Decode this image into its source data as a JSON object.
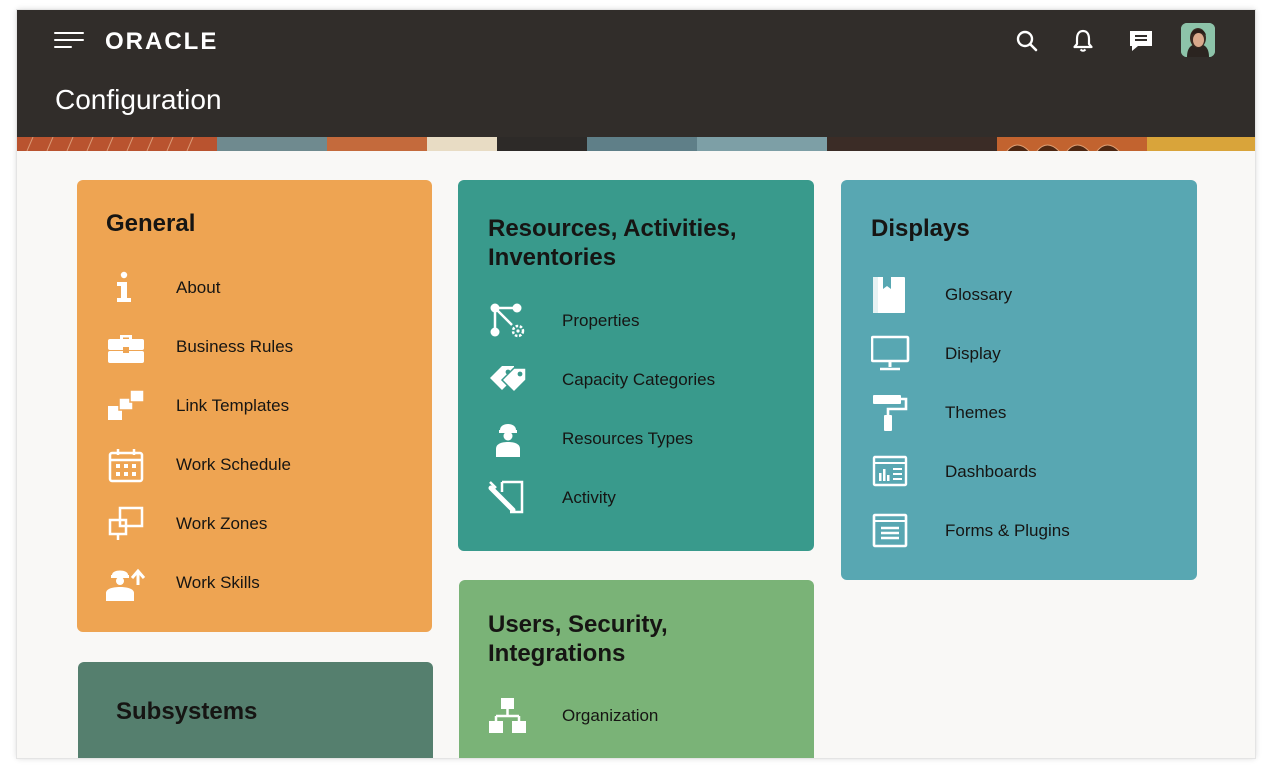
{
  "header": {
    "logo": "ORACLE",
    "title": "Configuration",
    "icons": [
      "menu-icon",
      "search-icon",
      "bell-icon",
      "chat-icon",
      "user-avatar"
    ]
  },
  "colors": {
    "header_bg": "#312d2a",
    "page_bg": "#f9f8f6",
    "general": "#eea452",
    "subsystems": "#557f6e",
    "resources": "#399a8c",
    "users": "#7ab377",
    "displays": "#58a7b2"
  },
  "cards": {
    "general": {
      "title": "General",
      "items": [
        {
          "label": "About",
          "icon": "info-icon"
        },
        {
          "label": "Business Rules",
          "icon": "briefcase-icon"
        },
        {
          "label": "Link Templates",
          "icon": "link-templates-icon"
        },
        {
          "label": "Work Schedule",
          "icon": "calendar-icon"
        },
        {
          "label": "Work Zones",
          "icon": "work-zones-icon"
        },
        {
          "label": "Work Skills",
          "icon": "work-skills-icon"
        }
      ]
    },
    "subsystems": {
      "title": "Subsystems"
    },
    "resources": {
      "title_line1": "Resources, Activities,",
      "title_line2": "Inventories",
      "items": [
        {
          "label": "Properties",
          "icon": "properties-icon"
        },
        {
          "label": "Capacity Categories",
          "icon": "tags-icon"
        },
        {
          "label": "Resources Types",
          "icon": "worker-icon"
        },
        {
          "label": "Activity",
          "icon": "activity-icon"
        }
      ]
    },
    "users": {
      "title_line1": "Users, Security,",
      "title_line2": "Integrations",
      "items": [
        {
          "label": "Organization",
          "icon": "org-chart-icon"
        }
      ]
    },
    "displays": {
      "title": "Displays",
      "items": [
        {
          "label": "Glossary",
          "icon": "book-icon"
        },
        {
          "label": "Display",
          "icon": "monitor-icon"
        },
        {
          "label": "Themes",
          "icon": "paint-roller-icon"
        },
        {
          "label": "Dashboards",
          "icon": "dashboard-icon"
        },
        {
          "label": "Forms & Plugins",
          "icon": "form-icon"
        }
      ]
    }
  }
}
